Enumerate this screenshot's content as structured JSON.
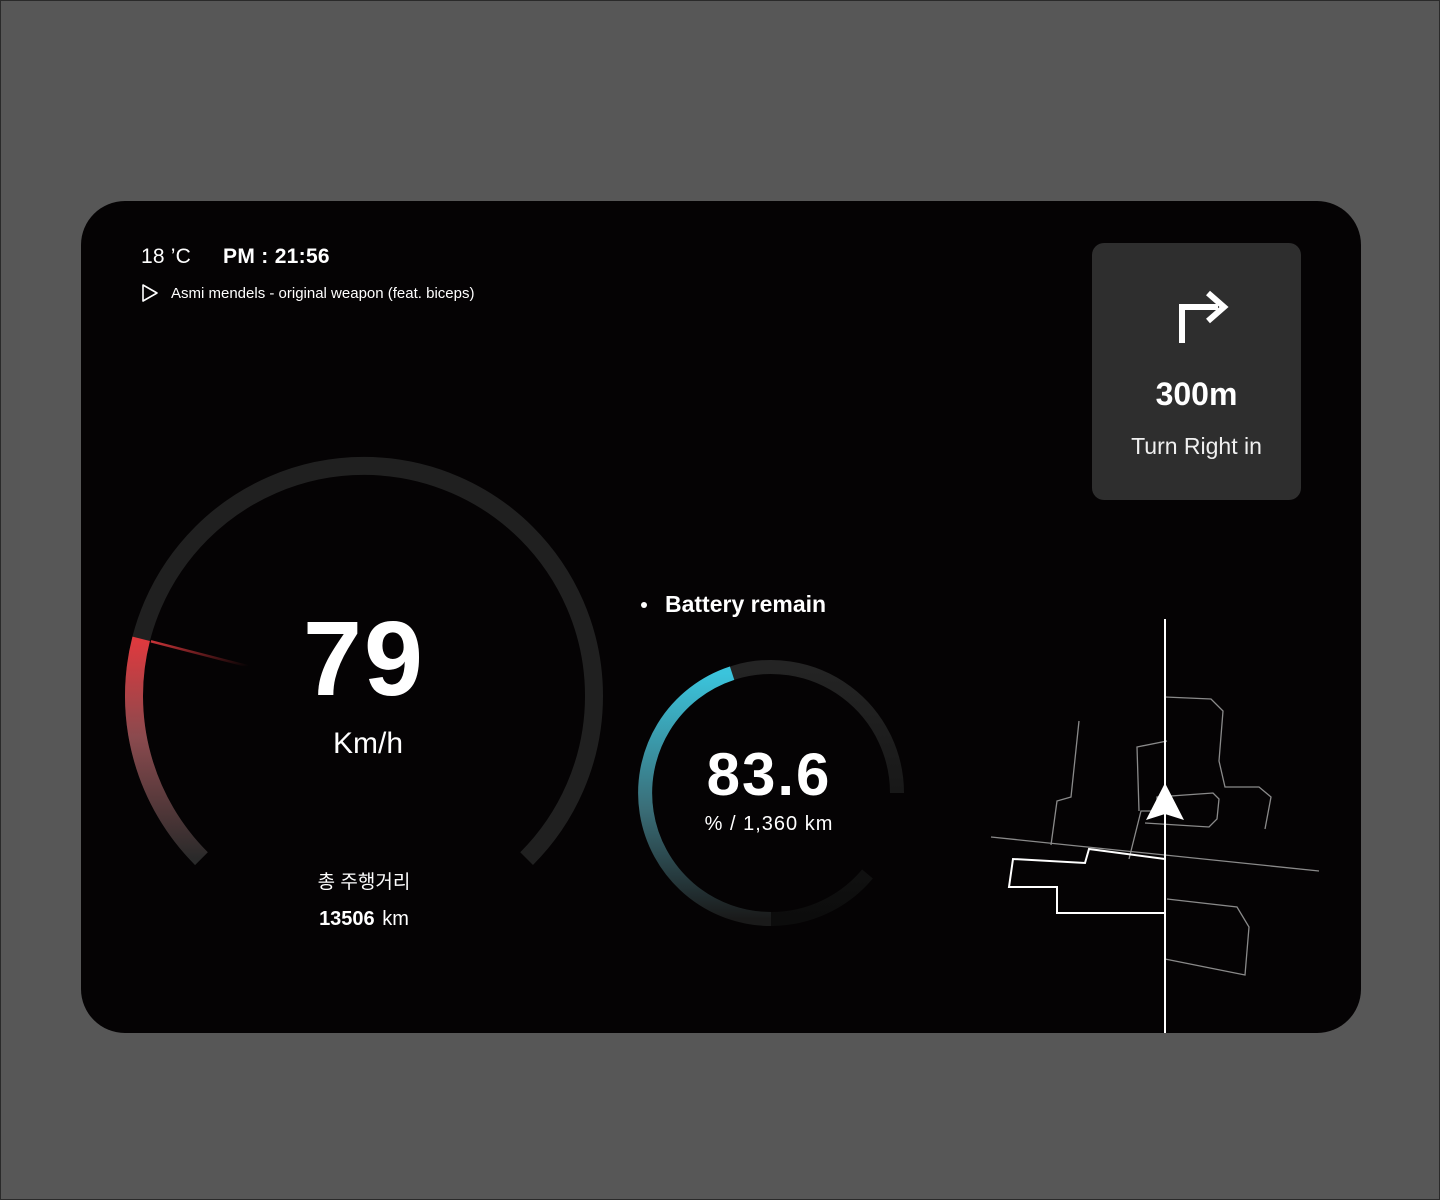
{
  "status": {
    "temperature": "18 ’C",
    "time": "PM : 21:56"
  },
  "media": {
    "icon": "play-icon",
    "now_playing": "Asmi mendels - original weapon (feat. biceps)"
  },
  "navigation": {
    "icon": "turn-right-icon",
    "distance": "300m",
    "instruction": "Turn Right in"
  },
  "speedometer": {
    "speed": "79",
    "unit": "Km/h",
    "speed_fraction": 0.22,
    "accent_color": "#e0393e",
    "track_color": "#202020"
  },
  "odometer": {
    "label": "총 주행거리",
    "value": "13506",
    "unit": "km"
  },
  "battery": {
    "title": "Battery remain",
    "percent": "83.6",
    "sub": "% / 1,360 km",
    "fill_fraction": 0.836,
    "accent_color": "#3bc4dc",
    "track_color": "#202020"
  }
}
